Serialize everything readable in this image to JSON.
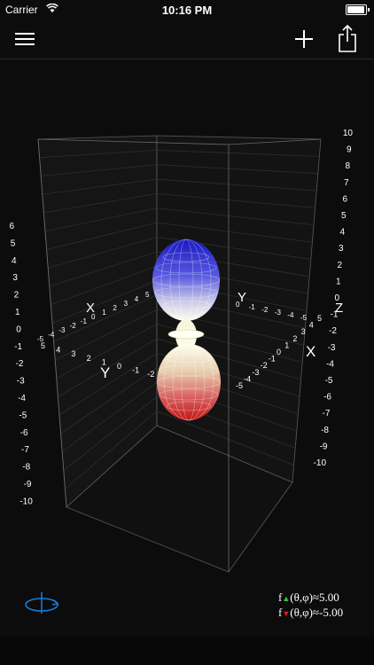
{
  "status_bar": {
    "carrier": "Carrier",
    "time": "10:16 PM",
    "battery_level": 1.0
  },
  "nav": {
    "menu_icon": "hamburger-menu-icon",
    "add_icon": "plus-icon",
    "share_icon": "share-icon"
  },
  "plot": {
    "type": "3d-surface-plot",
    "z_ticks_left": [
      "6",
      "5",
      "4",
      "3",
      "2",
      "1",
      "0",
      "-1",
      "-2",
      "-3",
      "-4",
      "-5",
      "-6",
      "-7",
      "-8",
      "-9",
      "-10"
    ],
    "z_ticks_right": [
      "10",
      "9",
      "8",
      "7",
      "6",
      "5",
      "4",
      "3",
      "2",
      "1",
      "0",
      "-1",
      "-2",
      "-3",
      "-4",
      "-5",
      "-6",
      "-7",
      "-8",
      "-9",
      "-10"
    ],
    "axis_labels": {
      "x_back": "X",
      "y_back": "Y",
      "z": "Z",
      "x_front": "X",
      "y_front": "Y"
    },
    "x_back_ticks": [
      "-5",
      "-4",
      "-3",
      "-2",
      "-1",
      "0",
      "1",
      "2",
      "3",
      "4",
      "5"
    ],
    "y_back_ticks": [
      "0",
      "-1",
      "-2",
      "-3",
      "-4",
      "-5"
    ],
    "y_front_ticks": [
      "5",
      "4",
      "3",
      "2",
      "1",
      "0",
      "-1",
      "-2",
      "-3",
      "-4",
      "-5"
    ],
    "x_front_ticks": [
      "-5",
      "-4",
      "-3",
      "-2",
      "-1",
      "0",
      "1",
      "2",
      "3",
      "4",
      "5"
    ],
    "colors": {
      "top_lobe": "#1a22c8",
      "bottom_lobe": "#c81818",
      "middle": "#fffff0"
    }
  },
  "rotate_icon": "rotate-3d-icon",
  "readout": {
    "f_max_label": "f",
    "f_max_expr": "(θ,φ)≈5.00",
    "f_min_label": "f",
    "f_min_expr": "(θ,φ)≈-5.00"
  }
}
